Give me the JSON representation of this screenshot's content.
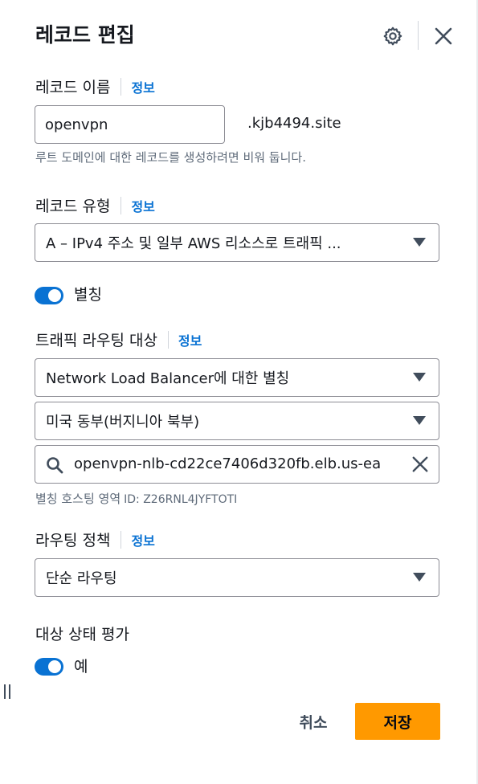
{
  "header": {
    "title": "레코드 편집"
  },
  "record_name": {
    "label": "레코드 이름",
    "info": "정보",
    "value": "openvpn",
    "suffix": ".kjb4494.site",
    "hint": "루트 도메인에 대한 레코드를 생성하려면 비워 둡니다."
  },
  "record_type": {
    "label": "레코드 유형",
    "info": "정보",
    "selected": "A – IPv4 주소 및 일부 AWS 리소스로 트래픽 ..."
  },
  "alias": {
    "label": "별칭",
    "on": true
  },
  "traffic_target": {
    "label": "트래픽 라우팅 대상",
    "info": "정보",
    "endpoint_selected": "Network Load Balancer에 대한 별칭",
    "region_selected": "미국 동부(버지니아 북부)",
    "search_value": "openvpn-nlb-cd22ce7406d320fb.elb.us-ea",
    "zone_label": "별칭 호스팅 영역",
    "zone_id": "ID: Z26RNL4JYFTOTI"
  },
  "routing_policy": {
    "label": "라우팅 정책",
    "info": "정보",
    "selected": "단순 라우팅"
  },
  "health": {
    "label": "대상 상태 평가",
    "toggle_label": "예",
    "on": true
  },
  "footer": {
    "cancel_label": "취소",
    "save_label": "저장"
  },
  "colors": {
    "accent": "#0972d3",
    "primary_button": "#ff9900"
  },
  "icons": [
    "gear-icon",
    "close-icon",
    "caret-down-icon",
    "search-icon",
    "clear-icon",
    "resize-grip-icon"
  ]
}
